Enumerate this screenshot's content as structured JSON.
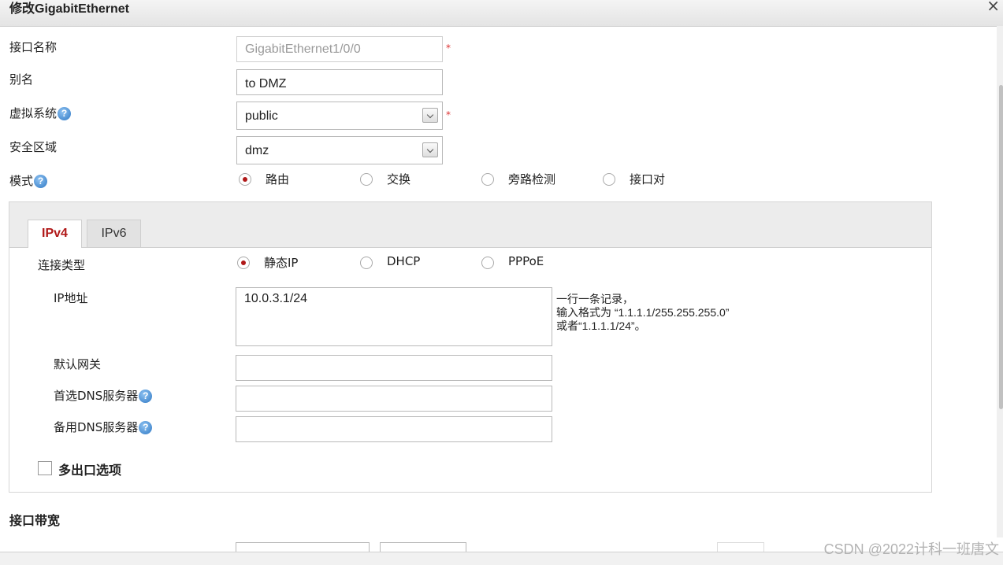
{
  "dialog": {
    "title": "修改GigabitEthernet",
    "close": "×"
  },
  "form": {
    "interface_name": {
      "label": "接口名称",
      "value": "GigabitEthernet1/0/0",
      "required": "*"
    },
    "alias": {
      "label": "别名",
      "value": "to DMZ"
    },
    "vsys": {
      "label": "虚拟系统",
      "help": "?",
      "value": "public",
      "required": "*"
    },
    "zone": {
      "label": "安全区域",
      "value": "dmz"
    },
    "mode": {
      "label": "模式",
      "help": "?",
      "options": [
        "路由",
        "交换",
        "旁路检测",
        "接口对"
      ],
      "selected": "路由"
    }
  },
  "tabs": [
    {
      "label": "IPv4",
      "active": true
    },
    {
      "label": "IPv6",
      "active": false
    }
  ],
  "ipv4": {
    "conn_type": {
      "label": "连接类型",
      "options": [
        "静态IP",
        "DHCP",
        "PPPoE"
      ],
      "selected": "静态IP"
    },
    "ip": {
      "label": "IP地址",
      "value": "10.0.3.1/24"
    },
    "hint": {
      "line1": "一行一条记录，",
      "line2": "输入格式为 “1.1.1.1/255.255.255.0”",
      "line3": "或者“1.1.1.1/24”。"
    },
    "gateway": {
      "label": "默认网关",
      "value": ""
    },
    "dns1": {
      "label": "首选DNS服务器",
      "help": "?",
      "value": ""
    },
    "dns2": {
      "label": "备用DNS服务器",
      "help": "?",
      "value": ""
    },
    "multi_exit": {
      "label": "多出口选项",
      "checked": false
    }
  },
  "bandwidth": {
    "label": "接口带宽"
  },
  "watermark": "CSDN @2022计科一班唐文"
}
